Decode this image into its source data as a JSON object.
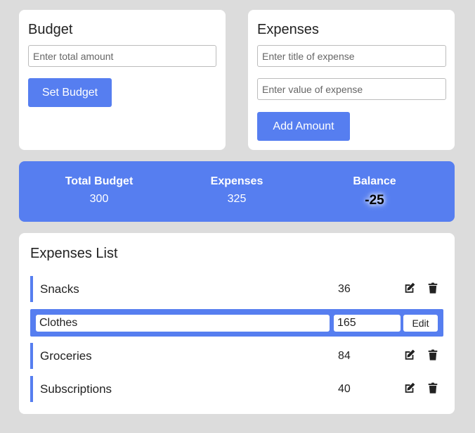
{
  "colors": {
    "accent": "#567ef0",
    "card": "#ffffff",
    "background": "#dcdcdc"
  },
  "budget": {
    "title": "Budget",
    "input_placeholder": "Enter total amount",
    "button_label": "Set Budget"
  },
  "expenses_form": {
    "title": "Expenses",
    "title_placeholder": "Enter title of expense",
    "value_placeholder": "Enter value of expense",
    "button_label": "Add Amount"
  },
  "summary": {
    "total_budget_label": "Total Budget",
    "total_budget_value": "300",
    "expenses_label": "Expenses",
    "expenses_value": "325",
    "balance_label": "Balance",
    "balance_value": "-25"
  },
  "expenses_list": {
    "title": "Expenses List",
    "items": [
      {
        "title": "Snacks",
        "value": "36",
        "edit_icon": "edit-icon",
        "delete_icon": "trash-icon"
      },
      {
        "title": "Clothes",
        "value": "165",
        "editing": true,
        "edit_button_label": "Edit"
      },
      {
        "title": "Groceries",
        "value": "84",
        "edit_icon": "edit-icon",
        "delete_icon": "trash-icon"
      },
      {
        "title": "Subscriptions",
        "value": "40",
        "edit_icon": "edit-icon",
        "delete_icon": "trash-icon"
      }
    ]
  }
}
